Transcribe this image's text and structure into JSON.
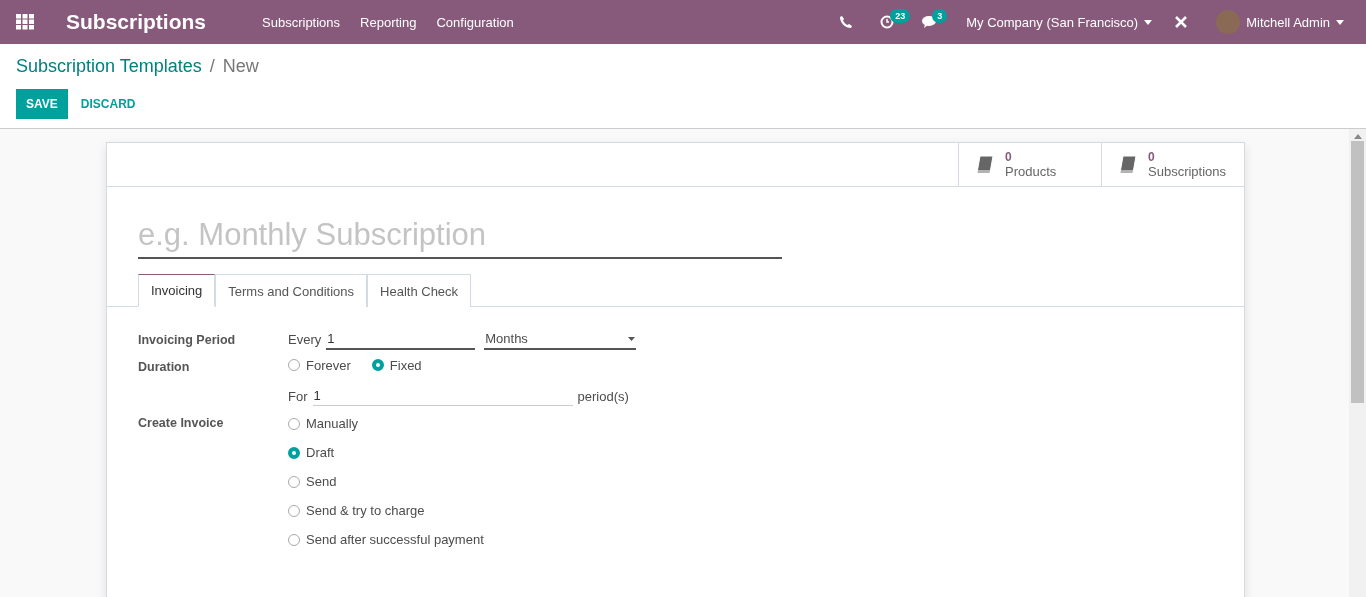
{
  "navbar": {
    "app_title": "Subscriptions",
    "menu": [
      "Subscriptions",
      "Reporting",
      "Configuration"
    ],
    "activity_count": "23",
    "message_count": "3",
    "company": "My Company (San Francisco)",
    "user": "Mitchell Admin"
  },
  "breadcrumb": {
    "parent": "Subscription Templates",
    "separator": "/",
    "current": "New"
  },
  "buttons": {
    "save": "SAVE",
    "discard": "DISCARD"
  },
  "smart_buttons": [
    {
      "count": "0",
      "label": "Products"
    },
    {
      "count": "0",
      "label": "Subscriptions"
    }
  ],
  "name_field": {
    "placeholder": "e.g. Monthly Subscription"
  },
  "tabs": [
    {
      "label": "Invoicing",
      "selected": true
    },
    {
      "label": "Terms and Conditions",
      "selected": false
    },
    {
      "label": "Health Check",
      "selected": false
    }
  ],
  "invoicing_period": {
    "label": "Invoicing Period",
    "prefix": "Every",
    "value": "1",
    "unit": "Months"
  },
  "duration": {
    "label": "Duration",
    "options": [
      {
        "label": "Forever",
        "selected": false
      },
      {
        "label": "Fixed",
        "selected": true
      }
    ],
    "prefix": "For",
    "value": "1",
    "suffix": "period(s)"
  },
  "create_invoice": {
    "label": "Create Invoice",
    "options": [
      {
        "label": "Manually",
        "selected": false
      },
      {
        "label": "Draft",
        "selected": true
      },
      {
        "label": "Send",
        "selected": false
      },
      {
        "label": "Send & try to charge",
        "selected": false
      },
      {
        "label": "Send after successful payment",
        "selected": false
      }
    ]
  }
}
